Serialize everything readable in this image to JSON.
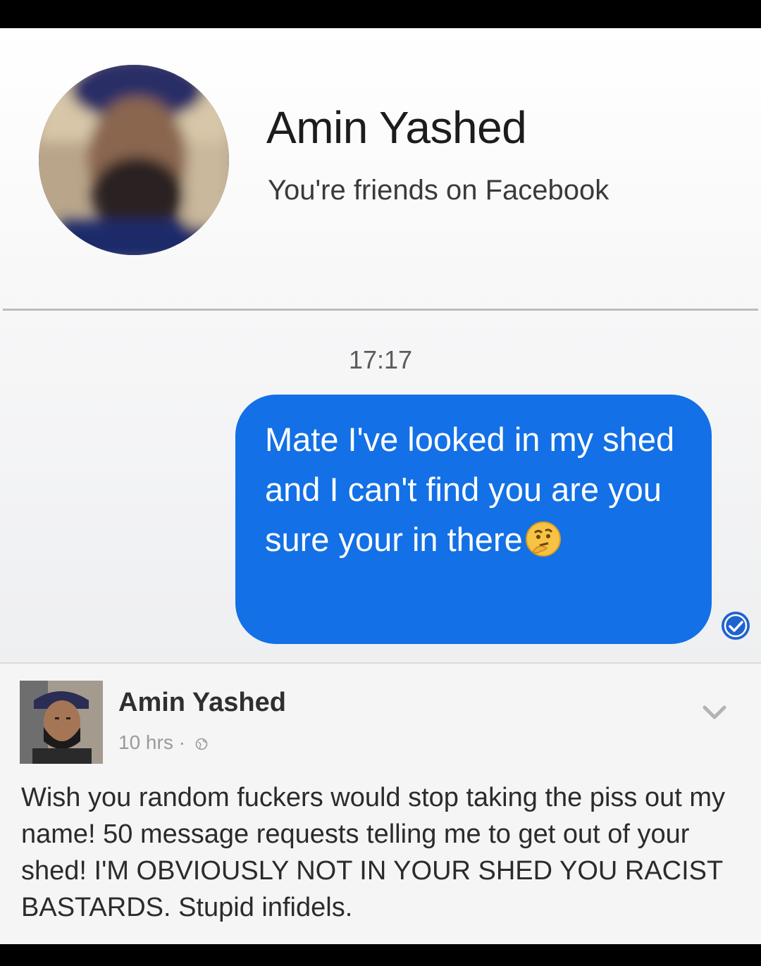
{
  "contact": {
    "name": "Amin Yashed",
    "relation": "You're friends on Facebook"
  },
  "conversation": {
    "timestamp": "17:17",
    "message": {
      "text": "Mate I've looked in my shed and I can't find you are you sure your in there",
      "emoji": "thinking-face",
      "bubble_color": "#1370e6"
    }
  },
  "post": {
    "author": "Amin Yashed",
    "time": "10 hrs",
    "visibility_icon": "globe-icon",
    "body": "Wish you random fuckers would stop taking the piss out my name! 50 message requests telling me to get out of your shed! I'M OBVIOUSLY NOT IN YOUR SHED YOU RACIST BASTARDS. Stupid infidels."
  }
}
